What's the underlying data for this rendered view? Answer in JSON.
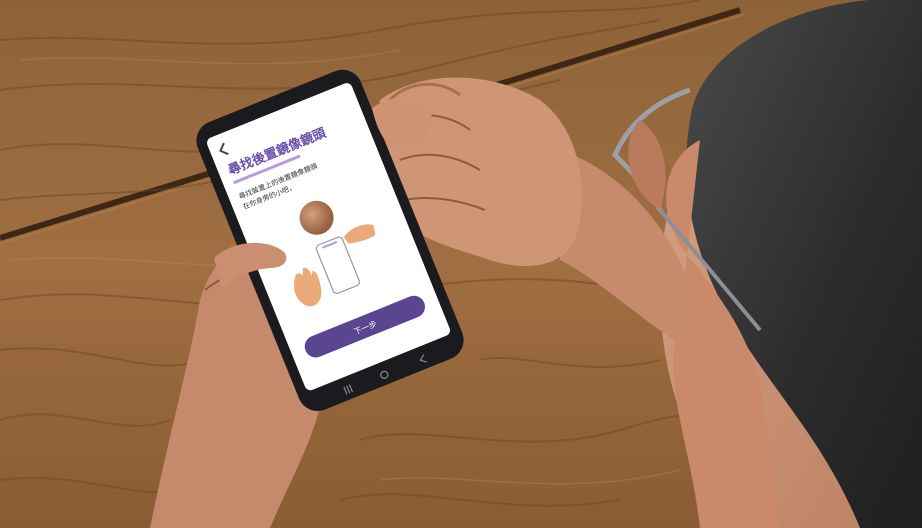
{
  "scene": {
    "description_alt": "photo",
    "colors": {
      "wood": "#9a6a3e",
      "wood_dark": "#6e4726",
      "skin": "#c98f73",
      "accent": "#5a4590",
      "accent_light": "#b79be0",
      "screen_bg": "#ffffff",
      "phone_body": "#1b1b1f"
    }
  },
  "phone_screen": {
    "back_icon": "chevron-left-icon",
    "title": "尋找後置鏡像鏡頭",
    "body_line_1": "尋找裝置上的後置鏡像鏡頭",
    "body_line_2": "在你身旁的小吧，",
    "next_button_label": "下一步",
    "nav_icons": [
      "recent-apps-icon",
      "home-icon",
      "back-icon"
    ]
  }
}
